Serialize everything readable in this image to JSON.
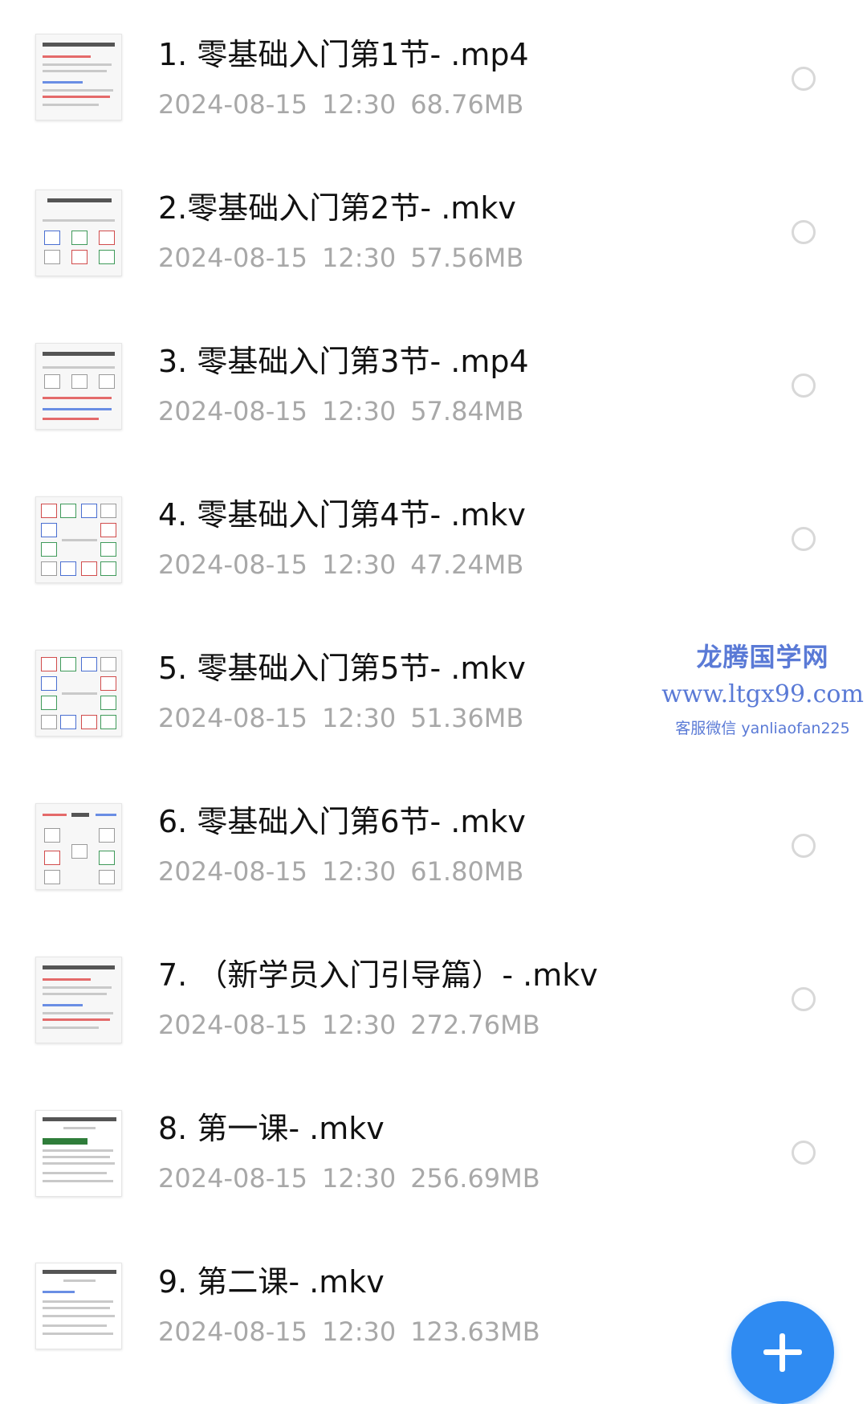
{
  "files": [
    {
      "name": "1. 零基础入门第1节-  .mp4",
      "date": "2024-08-15",
      "time": "12:30",
      "size": "68.76MB",
      "thumb_icon": "document-thumbnail-icon"
    },
    {
      "name": "2.零基础入门第2节-  .mkv",
      "date": "2024-08-15",
      "time": "12:30",
      "size": "57.56MB",
      "thumb_icon": "table-thumbnail-icon"
    },
    {
      "name": "3. 零基础入门第3节-  .mp4",
      "date": "2024-08-15",
      "time": "12:30",
      "size": "57.84MB",
      "thumb_icon": "table-thumbnail-icon"
    },
    {
      "name": "4. 零基础入门第4节-  .mkv",
      "date": "2024-08-15",
      "time": "12:30",
      "size": "47.24MB",
      "thumb_icon": "chart-grid-thumbnail-icon"
    },
    {
      "name": "5. 零基础入门第5节-  .mkv",
      "date": "2024-08-15",
      "time": "12:30",
      "size": "51.36MB",
      "thumb_icon": "chart-grid-thumbnail-icon"
    },
    {
      "name": "6. 零基础入门第6节-  .mkv",
      "date": "2024-08-15",
      "time": "12:30",
      "size": "61.80MB",
      "thumb_icon": "diagram-thumbnail-icon"
    },
    {
      "name": "7. （新学员入门引导篇）-  .mkv",
      "date": "2024-08-15",
      "time": "12:30",
      "size": "272.76MB",
      "thumb_icon": "document-thumbnail-icon"
    },
    {
      "name": "8.  第一课-  .mkv",
      "date": "2024-08-15",
      "time": "12:30",
      "size": "256.69MB",
      "thumb_icon": "document-thumbnail-icon"
    },
    {
      "name": "9.  第二课-  .mkv",
      "date": "2024-08-15",
      "time": "12:30",
      "size": "123.63MB",
      "thumb_icon": "document-thumbnail-icon"
    }
  ],
  "watermark": {
    "line1": "龙腾国学网",
    "line2": "www.ltgx99.com",
    "line3": "客服微信 yanliaofan225"
  },
  "fab": {
    "icon": "plus-icon"
  },
  "colors": {
    "title_text": "#111111",
    "meta_text": "#a8a8a8",
    "watermark": "#5a7ad6",
    "fab": "#2f8bf2"
  }
}
